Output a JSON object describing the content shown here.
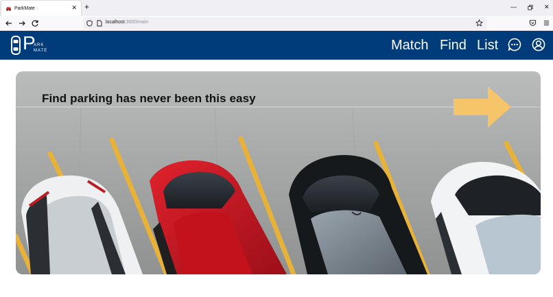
{
  "browser": {
    "tab_title": "ParkMate",
    "url_host": "localhost",
    "url_path": ":3000/main"
  },
  "header": {
    "bg_color": "#003B7A",
    "logo_main": "P",
    "logo_sub1": "ARK",
    "logo_sub2": "MATE",
    "nav": [
      {
        "label": "Match"
      },
      {
        "label": "Find"
      },
      {
        "label": "List"
      }
    ],
    "icons": [
      "chat-icon",
      "account-icon"
    ]
  },
  "hero": {
    "title": "Find parking has never been this easy",
    "arrow_color": "#F6C56A",
    "stripe_color": "#E8B23A"
  }
}
